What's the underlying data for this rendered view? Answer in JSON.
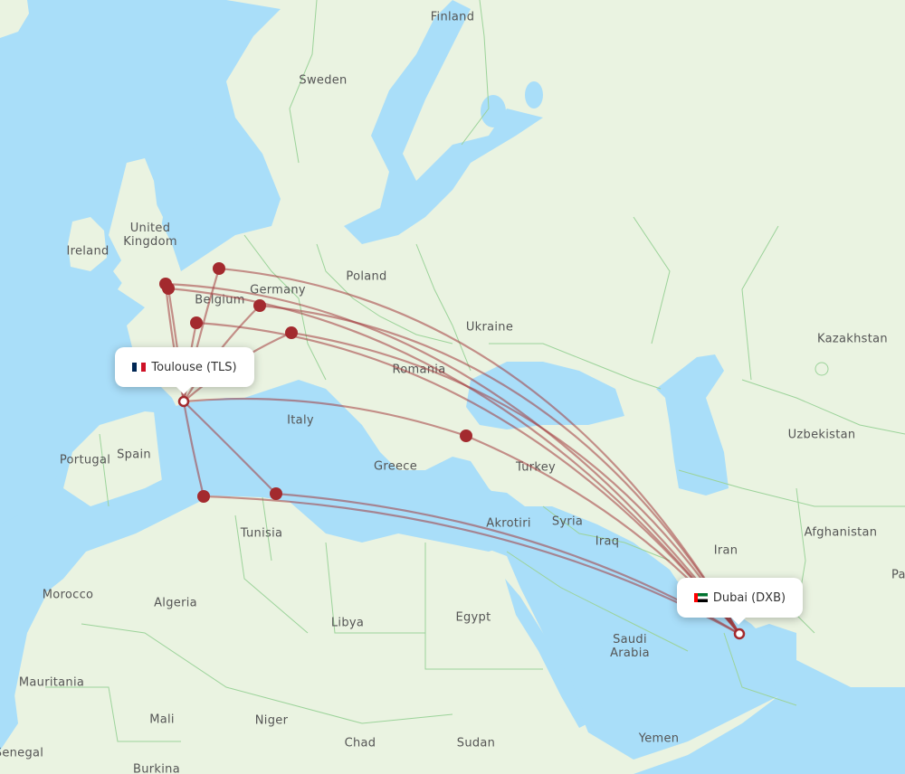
{
  "map": {
    "colors": {
      "water": "#a9def9",
      "land": "#eaf3e1",
      "border": "#9cd39a",
      "route": "#a23a3e",
      "marker": "#a32a2e"
    },
    "origin": {
      "city": "Toulouse",
      "code": "TLS",
      "label": "Toulouse (TLS)",
      "flag": "france-flag-icon"
    },
    "destination": {
      "city": "Dubai",
      "code": "DXB",
      "label": "Dubai (DXB)",
      "flag": "uae-flag-icon"
    },
    "country_labels": [
      {
        "name": "Finland"
      },
      {
        "name": "Sweden"
      },
      {
        "name": "United Kingdom"
      },
      {
        "name": "Ireland"
      },
      {
        "name": "Poland"
      },
      {
        "name": "Belgium"
      },
      {
        "name": "Germany"
      },
      {
        "name": "Ukraine"
      },
      {
        "name": "Kazakhstan"
      },
      {
        "name": "Romania"
      },
      {
        "name": "Italy"
      },
      {
        "name": "Uzbekistan"
      },
      {
        "name": "Portugal"
      },
      {
        "name": "Spain"
      },
      {
        "name": "Greece"
      },
      {
        "name": "Turkey"
      },
      {
        "name": "Akrotiri"
      },
      {
        "name": "Syria"
      },
      {
        "name": "Tunisia"
      },
      {
        "name": "Iraq"
      },
      {
        "name": "Afghanistan"
      },
      {
        "name": "Iran"
      },
      {
        "name": "Pakistan"
      },
      {
        "name": "Morocco"
      },
      {
        "name": "Algeria"
      },
      {
        "name": "Libya"
      },
      {
        "name": "Egypt"
      },
      {
        "name": "Saudi Arabia"
      },
      {
        "name": "Mauritania"
      },
      {
        "name": "Mali"
      },
      {
        "name": "Niger"
      },
      {
        "name": "Chad"
      },
      {
        "name": "Sudan"
      },
      {
        "name": "Yemen"
      },
      {
        "name": "Senegal"
      },
      {
        "name": "Burkina"
      }
    ],
    "stopover_markers": [
      {
        "name": "London Heathrow area"
      },
      {
        "name": "London area"
      },
      {
        "name": "Amsterdam"
      },
      {
        "name": "Paris"
      },
      {
        "name": "Frankfurt"
      },
      {
        "name": "Munich"
      },
      {
        "name": "Istanbul"
      },
      {
        "name": "Algiers"
      },
      {
        "name": "Tunis"
      }
    ]
  }
}
